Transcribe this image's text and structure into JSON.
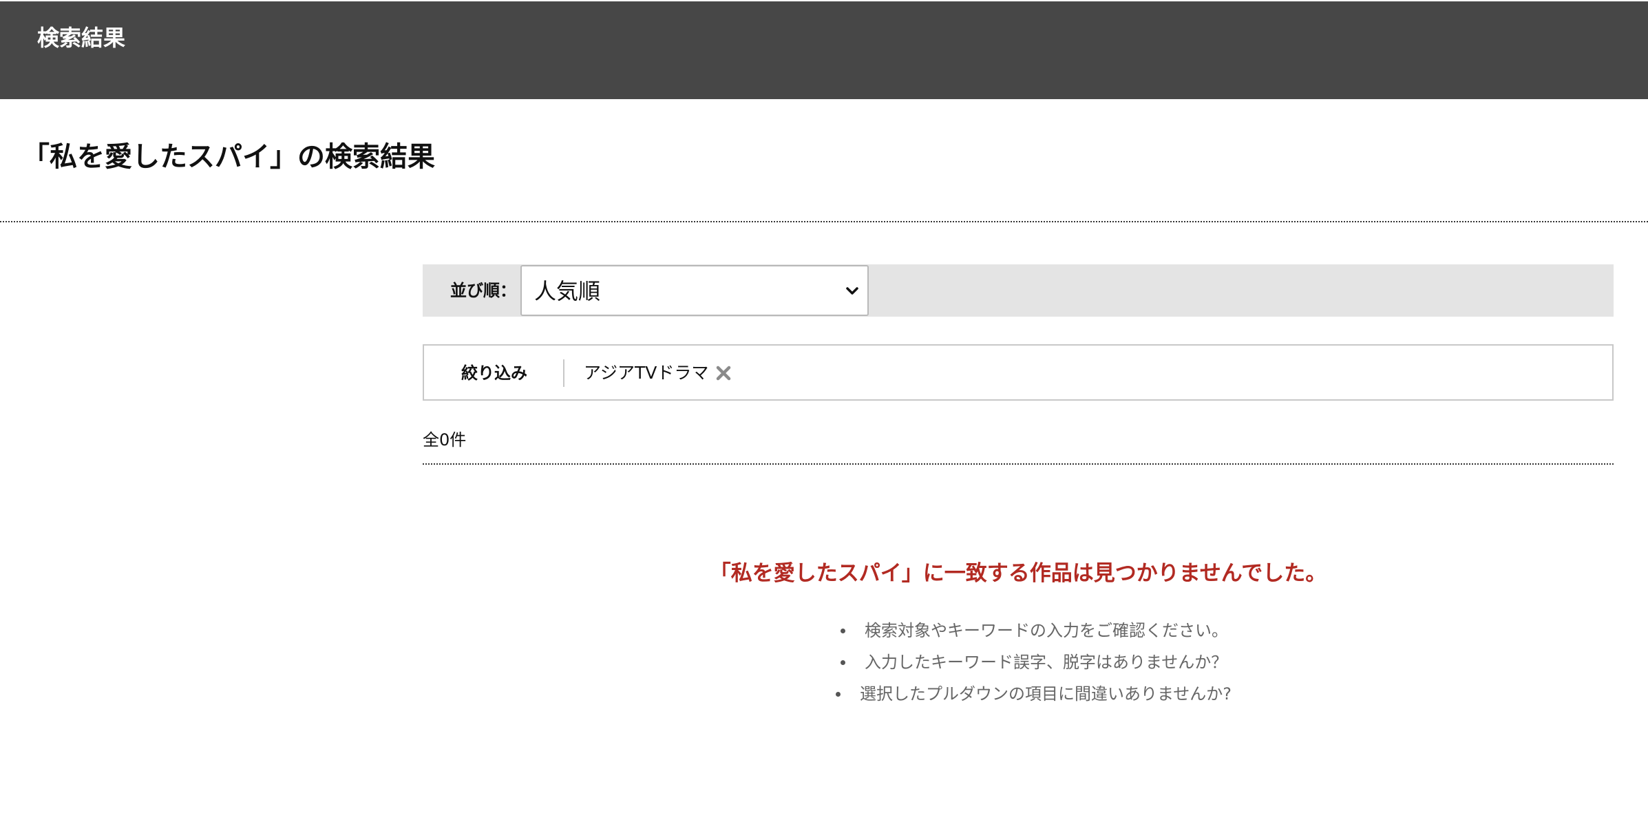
{
  "header": {
    "title": "検索結果"
  },
  "page": {
    "title": "「私を愛したスパイ」の検索結果"
  },
  "sort": {
    "label": "並び順：",
    "selected": "人気順"
  },
  "filter": {
    "label": "絞り込み",
    "tags": [
      {
        "label": "アジアTVドラマ",
        "icon": "close-icon"
      }
    ]
  },
  "results": {
    "count_text": "全0件",
    "message": "「私を愛したスパイ」に一致する作品は見つかりませんでした。",
    "hints": [
      "検索対象やキーワードの入力をご確認ください。",
      "入力したキーワード誤字、脱字はありませんか？",
      "選択したプルダウンの項目に間違いありませんか?"
    ]
  },
  "colors": {
    "header_bg": "#474747",
    "sort_bar_bg": "#e4e4e4",
    "message_red": "#b22a22",
    "hint_gray": "#666666"
  }
}
